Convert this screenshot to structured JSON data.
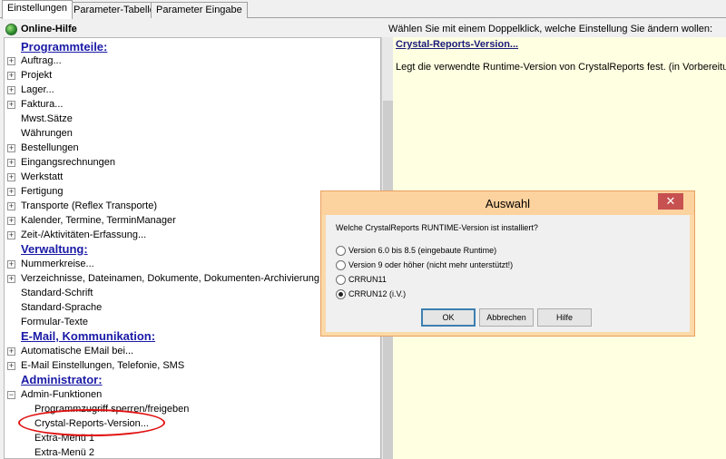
{
  "tabs": [
    {
      "label": "Einstellungen",
      "active": true
    },
    {
      "label": "Parameter-Tabelle",
      "active": false
    },
    {
      "label": "Parameter Eingabe",
      "active": false
    }
  ],
  "toolbar": {
    "help_label": "Online-Hilfe",
    "instruction": "Wählen Sie mit einem Doppelklick, welche Einstellung Sie ändern wollen:"
  },
  "tree": {
    "sections": {
      "programmteile": "Programmteile:",
      "verwaltung": "Verwaltung:",
      "email": "E-Mail, Kommunikation:",
      "administrator": "Administrator:"
    },
    "items": {
      "auftrag": "Auftrag...",
      "projekt": "Projekt",
      "lager": "Lager...",
      "faktura": "Faktura...",
      "mwst": "Mwst.Sätze",
      "waehrungen": "Währungen",
      "bestellungen": "Bestellungen",
      "eingangsrechnungen": "Eingangsrechnungen",
      "werkstatt": "Werkstatt",
      "fertigung": "Fertigung",
      "transporte": "Transporte (Reflex Transporte)",
      "kalender": "Kalender, Termine, TerminManager",
      "zeit": "Zeit-/Aktivitäten-Erfassung...",
      "nummernkreise": "Nummerkreise...",
      "verzeichnisse": "Verzeichnisse, Dateinamen, Dokumente, Dokumenten-Archivierung...",
      "standard_schrift": "Standard-Schrift",
      "standard_sprache": "Standard-Sprache",
      "formular_texte": "Formular-Texte",
      "auto_email": "Automatische EMail bei...",
      "email_einstellungen": "E-Mail Einstellungen, Telefonie, SMS",
      "admin_funktionen": "Admin-Funktionen",
      "programmzugriff": "Programmzugriff sperren/freigeben",
      "crystal": "Crystal-Reports-Version...",
      "extra1": "Extra-Menü 1",
      "extra2": "Extra-Menü 2"
    },
    "expander_plus": "+",
    "expander_minus": "−"
  },
  "detail": {
    "title": "Crystal-Reports-Version...",
    "text": "Legt die verwendte Runtime-Version von CrystalReports fest. (in Vorbereitung!)"
  },
  "dialog": {
    "title": "Auswahl",
    "close_glyph": "✕",
    "question": "Welche CrystalReports RUNTIME-Version ist installiert?",
    "options": [
      {
        "label": "Version 6.0 bis 8.5 (eingebaute Runtime)",
        "checked": false
      },
      {
        "label": "Version 9 oder höher (nicht mehr unterstützt!)",
        "checked": false
      },
      {
        "label": "CRRUN11",
        "checked": false
      },
      {
        "label": "CRRUN12 (i.V.)",
        "checked": true
      }
    ],
    "ok_label": "OK",
    "cancel_label": "Abbrechen",
    "help_label": "Hilfe"
  },
  "colors": {
    "section_heading": "#1a1aa6",
    "detail_background": "#ffffe1",
    "dialog_titlebar": "#fcd29e",
    "close_button": "#c75050",
    "annotation": "#e01010"
  }
}
